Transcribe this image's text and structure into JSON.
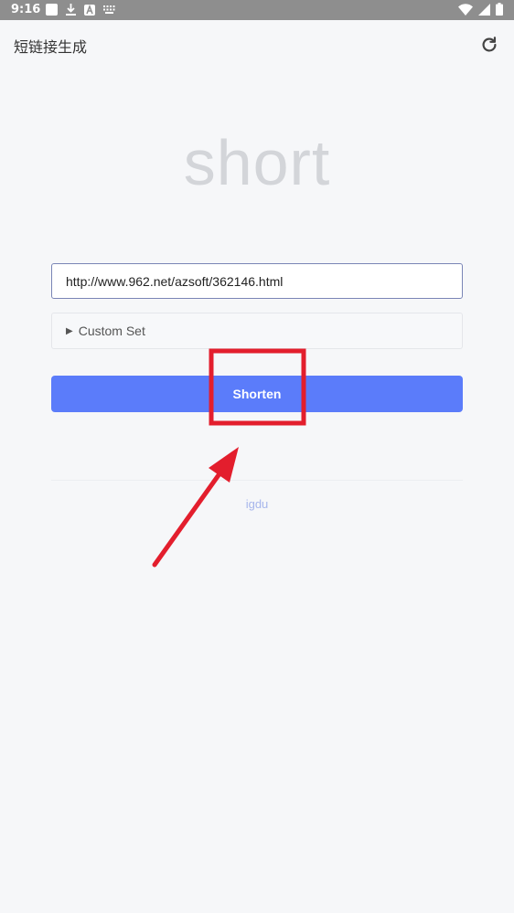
{
  "status_bar": {
    "time": "9:16"
  },
  "app_bar": {
    "title": "短链接生成"
  },
  "logo": {
    "text": "short"
  },
  "url_input": {
    "value": "http://www.962.net/azsoft/362146.html"
  },
  "custom_set": {
    "label": "Custom Set"
  },
  "shorten_button": {
    "label": "Shorten"
  },
  "footer": {
    "link": "igdu"
  },
  "annotation": {
    "color": "#e31e2d"
  },
  "colors": {
    "accent": "#5b7cfa",
    "logo": "#d3d5d9",
    "link": "#a7b6ec"
  }
}
